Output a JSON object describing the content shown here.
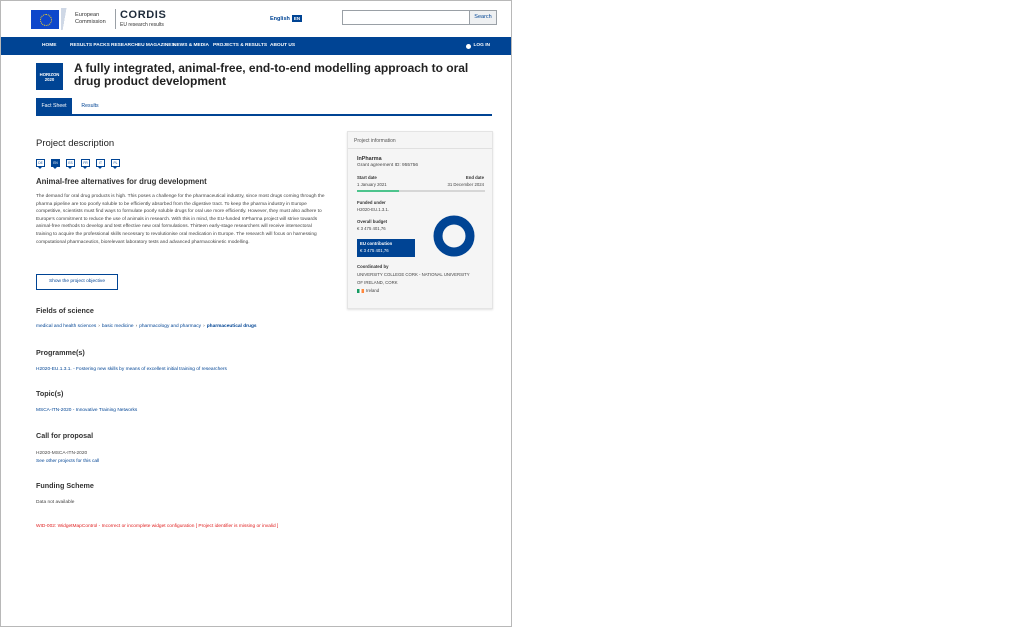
{
  "header": {
    "logo_lines": [
      "European",
      "Commission"
    ],
    "brand": "CORDIS",
    "brand_sub": "EU research results",
    "language": "English",
    "language_code": "EN",
    "search_placeholder": "",
    "search_button": "Search"
  },
  "nav": {
    "items": [
      "HOME",
      "RESULTS PACKS",
      "RESEARCHEU MAGAZINES",
      "NEWS & MEDIA",
      "PROJECTS & RESULTS",
      "ABOUT US"
    ],
    "login": "LOG IN"
  },
  "project": {
    "badge_lines": [
      "HORIZON",
      "2020"
    ],
    "title": "A fully integrated, animal-free, end-to-end modelling approach to oral drug product development"
  },
  "tabs": {
    "fact_sheet": "Fact Sheet",
    "results": "Results"
  },
  "description": {
    "heading": "Project description",
    "languages": [
      "DE",
      "EN",
      "ES",
      "FR",
      "IT",
      "PL"
    ],
    "active_language": "EN",
    "subheading": "Animal-free alternatives for drug development",
    "text": "The demand for oral drug products is high. This poses a challenge for the pharmaceutical industry, since most drugs coming through the pharma pipeline are too poorly soluble to be efficiently absorbed from the digestive tract. To keep the pharma industry in Europe competitive, scientists must find ways to formulate poorly soluble drugs for oral use more efficiently. However, they must also adhere to Europe's commitment to reduce the use of animals in research. With this in mind, the EU-funded InPharma project will strive towards animal-free methods to develop and test effective new oral formulations. Thirteen early-stage researchers will receive intersectoral training to acquire the professional skills necessary to revolutionise oral medication in Europe. The research will focus on harnessing computational pharmaceutics, biorelevant laboratory tests and advanced pharmacokinetic modelling.",
    "objective_button": "Show the project objective"
  },
  "fields": {
    "heading": "Fields of science",
    "crumbs": [
      "medical and health sciences",
      "basic medicine",
      "pharmacology and pharmacy",
      "pharmaceutical drugs"
    ]
  },
  "programme": {
    "heading": "Programme(s)",
    "link": "H2020-EU.1.3.1. - Fostering new skills by means of excellent initial training of researchers"
  },
  "topic": {
    "heading": "Topic(s)",
    "link": "MSCA-ITN-2020 - Innovative Training Networks"
  },
  "call": {
    "heading": "Call for proposal",
    "value": "H2020-MSCA-ITN-2020",
    "link": "See other projects for this call"
  },
  "funding": {
    "heading": "Funding Scheme",
    "value": "Data not available"
  },
  "error_message": "WID-002: WidgetMapControl - Incorrect or incomplete widget configuration [ Project identifier is missing or invalid ]",
  "info_card": {
    "header": "Project information",
    "acronym": "InPharma",
    "grant": "Grant agreement ID: 955756",
    "start_label": "Start date",
    "start_value": "1 January 2021",
    "end_label": "End date",
    "end_value": "31 December 2024",
    "progress_fraction": 0.33,
    "funded_label": "Funded under",
    "funded_value": "H2020-EU.1.3.1.",
    "budget_label": "Overall budget",
    "budget_value": "€ 3 475 401,76",
    "eu_label": "EU contribution",
    "eu_value": "€ 3 475 401,76",
    "eu_share": 1.0,
    "coordinated_label": "Coordinated by",
    "coordinator": "UNIVERSITY COLLEGE CORK - NATIONAL UNIVERSITY OF IRELAND, CORK",
    "country": "Ireland"
  },
  "colors": {
    "brand_blue": "#004494",
    "error_red": "#e02020",
    "progress_green": "#4dc48d"
  }
}
